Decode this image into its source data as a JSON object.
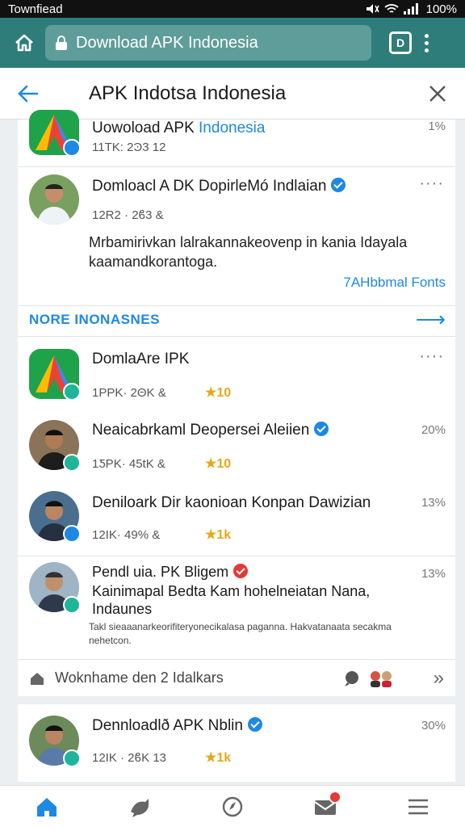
{
  "status_bar": {
    "left_text": "Townfiead",
    "battery": "100%"
  },
  "browser": {
    "url_text": "Download  APK Indonesia",
    "tab_count": "D"
  },
  "header": {
    "title": "APK Indotsa Indonesia"
  },
  "top_item": {
    "title_plain": "Uowoload APK ",
    "title_accent": "Indonesia",
    "meta": "11TK: 2Ͽ3  12",
    "pct": "1%"
  },
  "post": {
    "title": "Domloacl A DK DopirleMó Indlaian",
    "meta": "12R2 · 2ϐ3  &",
    "more": "····",
    "description": "Mrbamirivkan lalrakannakeovenp in kania Idayala kaamandkorantoga.",
    "link": "7AHbbmal Fonts"
  },
  "section": {
    "label": "NORE INONASNES",
    "arrow": "⟶"
  },
  "items": [
    {
      "title": "DomlaAre IPK",
      "meta": "1ΡΡK·  2ΘK  &",
      "rating": "★10",
      "right": "····",
      "verified": false
    },
    {
      "title": "Neaicabrkaml Deopersei Aleiien",
      "meta": "1ƼPK·  45tK  &",
      "rating": "★10",
      "right": "20%",
      "verified": true
    },
    {
      "title": "Deniloark Dir kaonioan Konpan Dawizian",
      "meta": "12IK·  49%  &",
      "rating": "★1k",
      "right": "13%",
      "verified": false
    },
    {
      "title": "Pendl uia. PK Bligem",
      "line2": "Kainimapal Bedta Kam hohelneiatan Nana,",
      "line3": "Indaunes",
      "small": "Takl sieaaanarkeorifiteryonecikalasa paganna. Hakvatanaata secakma nehetcon.",
      "right": "13%",
      "verified": true
    }
  ],
  "footer": {
    "text": "Woknhame den 2 Idalkars",
    "arrow": "»"
  },
  "bottom_card": {
    "title": "Dennloadlð APK Nblin",
    "meta": "12IK · 2ϐK 13",
    "rating": "★1k",
    "right": "30%"
  }
}
